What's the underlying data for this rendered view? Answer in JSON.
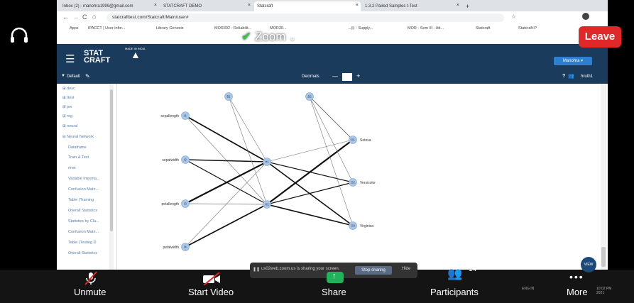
{
  "browser": {
    "tabs": [
      {
        "label": "Inbox (2) - manohra1999@gmail.com",
        "active": false
      },
      {
        "label": "STATCRAFT DEMO",
        "active": false
      },
      {
        "label": "Statcraft",
        "active": true
      },
      {
        "label": "1.3.2 Paired Samples t-Test",
        "active": false
      }
    ],
    "url": "statcrafttest.com/Statcraft/Main/user#",
    "bookmarks": [
      "Apps",
      "IPACCT | User infor...",
      "Library Genesis",
      "MOR302 - Reliabilit...",
      "MOR30...",
      "...(i) - Supply...",
      "MOR - Sem III - Att...",
      "Statcraft",
      "Statcraft-P"
    ]
  },
  "app": {
    "logo_line1": "STAT",
    "logo_line2": "CRAFT",
    "badge": "MADE IN INDIA",
    "user_menu": "Manohra ▾",
    "toolbar": {
      "default_label": "Default",
      "decimals_label": "Decimals",
      "minus": "—",
      "plus": "+",
      "help": "?",
      "user": "hruth1"
    },
    "sidebar": [
      {
        "label": "desc",
        "type": "group"
      },
      {
        "label": "ttest",
        "type": "group"
      },
      {
        "label": "pw",
        "type": "group"
      },
      {
        "label": "reg",
        "type": "group"
      },
      {
        "label": "neural",
        "type": "group"
      },
      {
        "label": "Neural Network",
        "type": "group-open"
      },
      {
        "label": "Dataframe",
        "type": "item"
      },
      {
        "label": "Train & Test",
        "type": "item"
      },
      {
        "label": "nnet",
        "type": "item"
      },
      {
        "label": "Variable Importa...",
        "type": "item"
      },
      {
        "label": "Confusion Matri...",
        "type": "item"
      },
      {
        "label": "Table (Training",
        "type": "item"
      },
      {
        "label": "Overall Statistics",
        "type": "item"
      },
      {
        "label": "Statistics by Cla...",
        "type": "item"
      },
      {
        "label": "Confusion Matri...",
        "type": "item"
      },
      {
        "label": "Table (Testing D",
        "type": "item"
      },
      {
        "label": "Overall Statistics",
        "type": "item"
      }
    ]
  },
  "network": {
    "bias_nodes": [
      "B1",
      "B2"
    ],
    "input_nodes": [
      {
        "id": "I1",
        "label": "sepallength"
      },
      {
        "id": "I2",
        "label": "sepalwidth"
      },
      {
        "id": "I3",
        "label": "petallength"
      },
      {
        "id": "I4",
        "label": "petalwidth"
      }
    ],
    "hidden_nodes": [
      "H1",
      "H2"
    ],
    "output_nodes": [
      {
        "id": "O1",
        "label": "Setosa"
      },
      {
        "id": "O2",
        "label": "Versicolor"
      },
      {
        "id": "O3",
        "label": "Virginica"
      }
    ]
  },
  "zoom": {
    "title": "Zoom",
    "leave": "Leave",
    "sharing_text": "us02web.zoom.us is sharing your screen.",
    "stop_sharing": "Stop sharing",
    "hide": "Hide",
    "unmute": "Unmute",
    "start_video": "Start Video",
    "share": "Share",
    "participants": "Participants",
    "participants_count": "14",
    "more": "More",
    "view": "VIEW"
  },
  "taskbar": {
    "lang": "ENG IN",
    "time": "10:02 PM",
    "date": "2021"
  }
}
